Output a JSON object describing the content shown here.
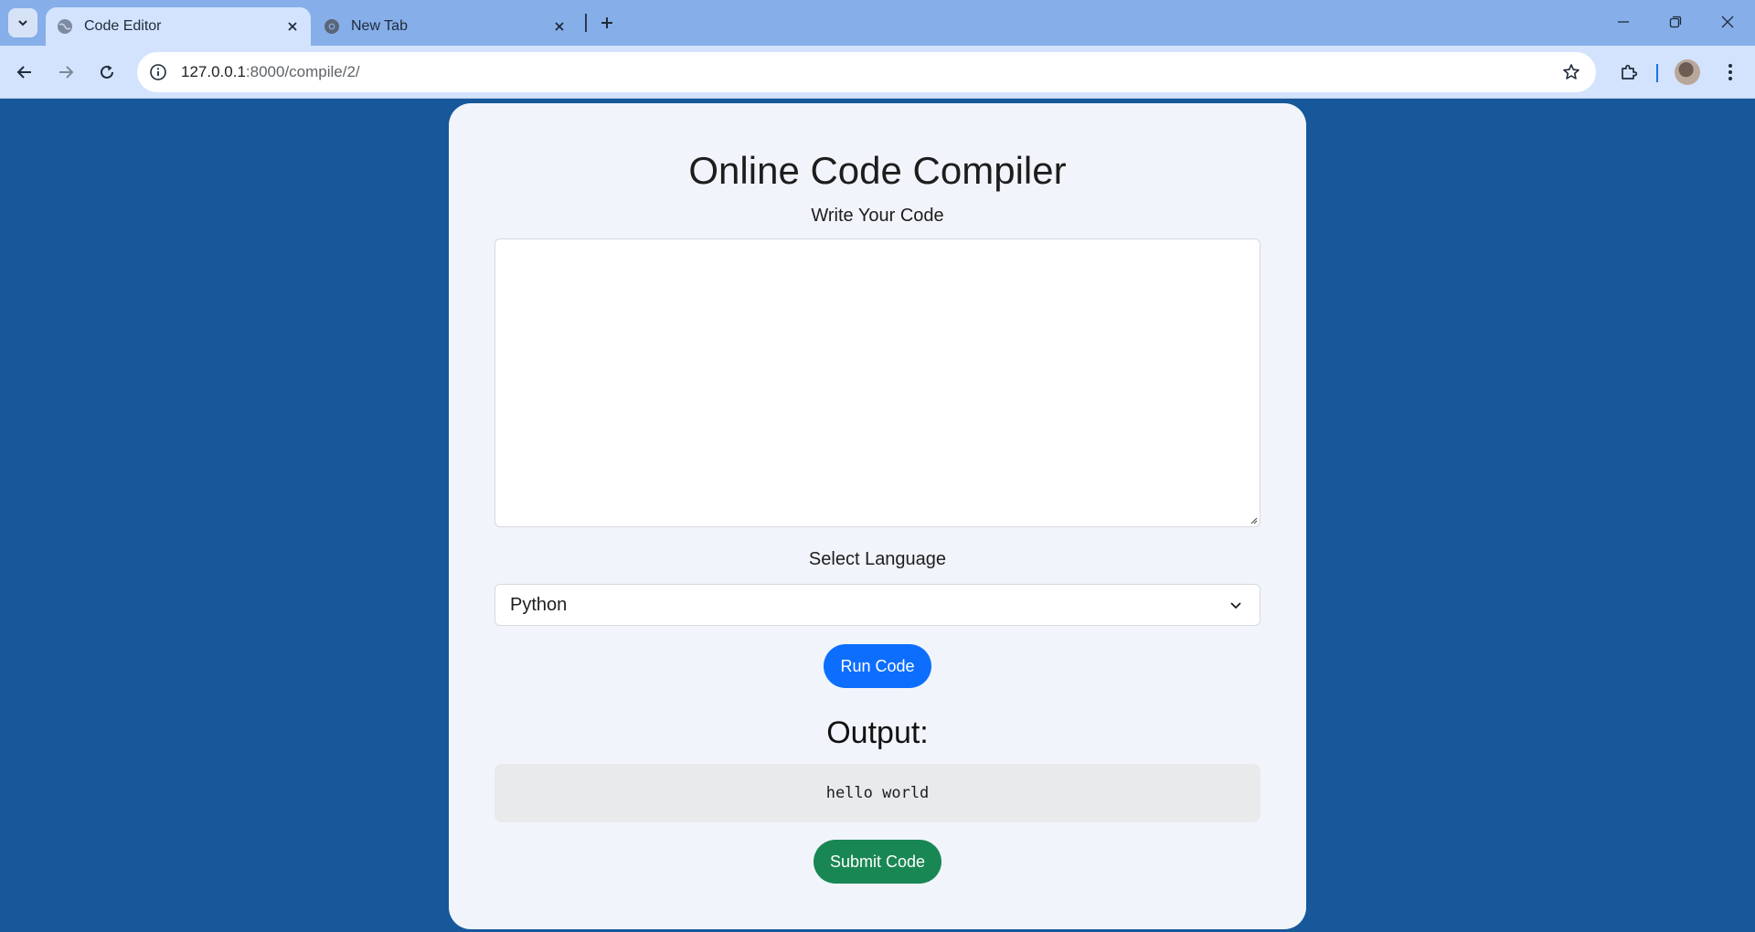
{
  "browser": {
    "tabs": [
      {
        "title": "Code Editor",
        "active": true,
        "favicon": "globe-icon"
      },
      {
        "title": "New Tab",
        "active": false,
        "favicon": "chrome-icon"
      }
    ],
    "url": {
      "host": "127.0.0.1",
      "path": ":8000/compile/2/"
    }
  },
  "page": {
    "title": "Online Code Compiler",
    "code_label": "Write Your Code",
    "code_value": "",
    "language_label": "Select Language",
    "language_selected": "Python",
    "run_button": "Run Code",
    "output_title": "Output:",
    "output_text": "hello world",
    "submit_button": "Submit Code"
  },
  "colors": {
    "page_background": "#16589a",
    "card_background": "#f1f5fb",
    "run_button": "#0d6efd",
    "submit_button": "#198754",
    "tabbar": "#86aee9",
    "toolbar": "#d3e3fd"
  }
}
